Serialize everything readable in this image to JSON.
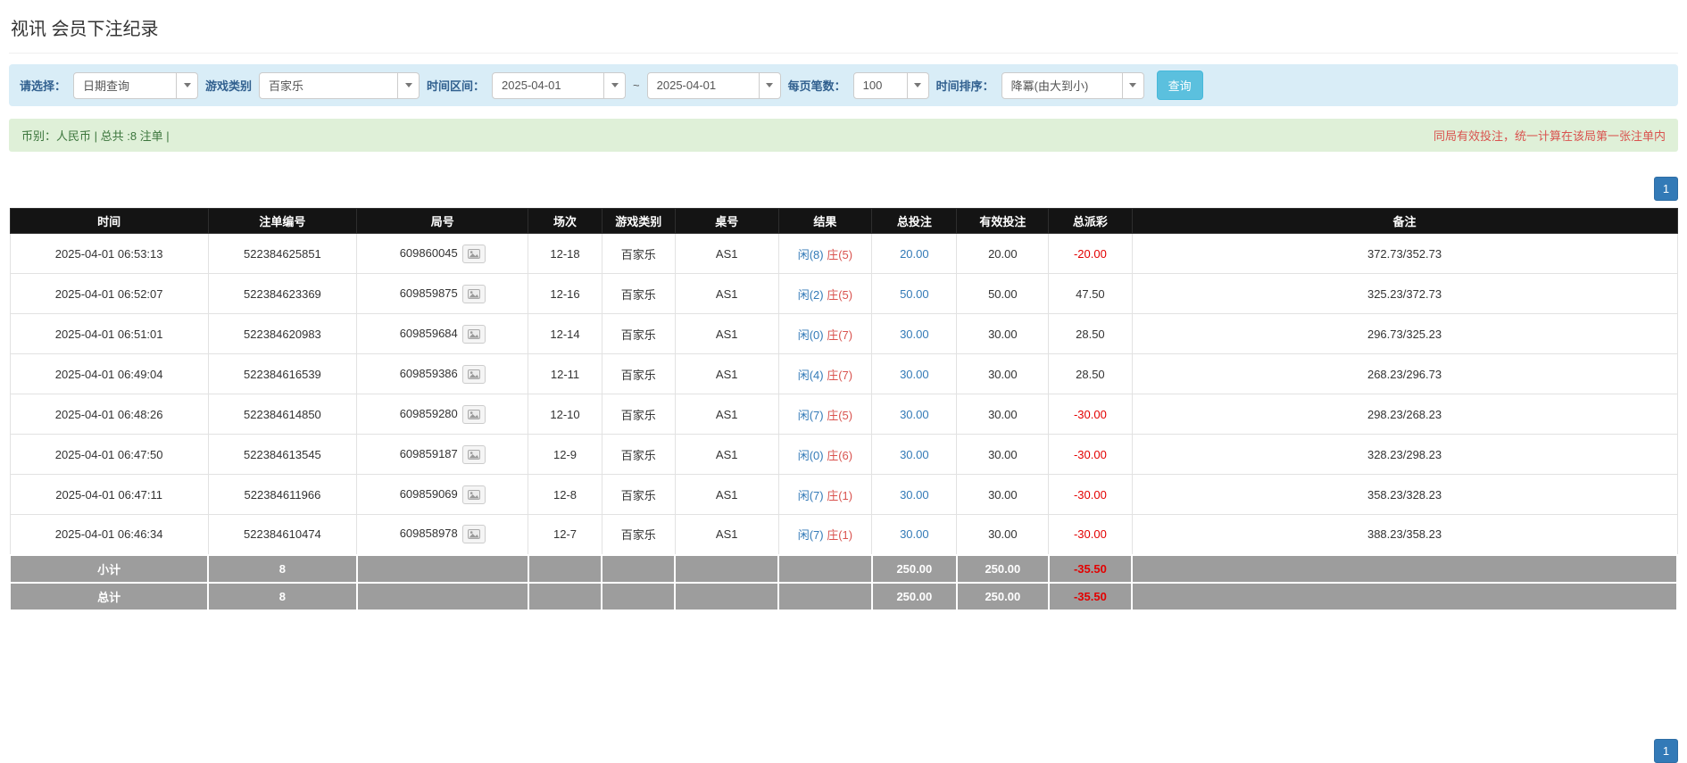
{
  "page": {
    "title": "视讯 会员下注纪录"
  },
  "filters": {
    "select_label": "请选择：",
    "select_value": "日期查询",
    "game_type_label": "游戏类别",
    "game_type_value": "百家乐",
    "date_range_label": "时间区间：",
    "date_from": "2025-04-01",
    "range_separator": "~",
    "date_to": "2025-04-01",
    "page_size_label": "每页笔数：",
    "page_size_value": "100",
    "sort_label": "时间排序：",
    "sort_value": "降冪(由大到小)",
    "search_button": "查询"
  },
  "summary": {
    "left": "币别：人民币 | 总共 :8 注单 |",
    "right": "同局有效投注，统一计算在该局第一张注单内"
  },
  "pagination": {
    "top_page": "1",
    "bottom_page": "1"
  },
  "table": {
    "headers": [
      "时间",
      "注单编号",
      "局号",
      "场次",
      "游戏类别",
      "桌号",
      "结果",
      "总投注",
      "有效投注",
      "总派彩",
      "备注"
    ],
    "rows": [
      {
        "time": "2025-04-01 06:53:13",
        "bet_id": "522384625851",
        "round_id": "609860045",
        "session": "12-18",
        "game": "百家乐",
        "table_no": "AS1",
        "result_player": "闲(8)",
        "result_banker": "庄(5)",
        "total_bet": "20.00",
        "valid_bet": "20.00",
        "payout": "-20.00",
        "note": "372.73/352.73"
      },
      {
        "time": "2025-04-01 06:52:07",
        "bet_id": "522384623369",
        "round_id": "609859875",
        "session": "12-16",
        "game": "百家乐",
        "table_no": "AS1",
        "result_player": "闲(2)",
        "result_banker": "庄(5)",
        "total_bet": "50.00",
        "valid_bet": "50.00",
        "payout": "47.50",
        "note": "325.23/372.73"
      },
      {
        "time": "2025-04-01 06:51:01",
        "bet_id": "522384620983",
        "round_id": "609859684",
        "session": "12-14",
        "game": "百家乐",
        "table_no": "AS1",
        "result_player": "闲(0)",
        "result_banker": "庄(7)",
        "total_bet": "30.00",
        "valid_bet": "30.00",
        "payout": "28.50",
        "note": "296.73/325.23"
      },
      {
        "time": "2025-04-01 06:49:04",
        "bet_id": "522384616539",
        "round_id": "609859386",
        "session": "12-11",
        "game": "百家乐",
        "table_no": "AS1",
        "result_player": "闲(4)",
        "result_banker": "庄(7)",
        "total_bet": "30.00",
        "valid_bet": "30.00",
        "payout": "28.50",
        "note": "268.23/296.73"
      },
      {
        "time": "2025-04-01 06:48:26",
        "bet_id": "522384614850",
        "round_id": "609859280",
        "session": "12-10",
        "game": "百家乐",
        "table_no": "AS1",
        "result_player": "闲(7)",
        "result_banker": "庄(5)",
        "total_bet": "30.00",
        "valid_bet": "30.00",
        "payout": "-30.00",
        "note": "298.23/268.23"
      },
      {
        "time": "2025-04-01 06:47:50",
        "bet_id": "522384613545",
        "round_id": "609859187",
        "session": "12-9",
        "game": "百家乐",
        "table_no": "AS1",
        "result_player": "闲(0)",
        "result_banker": "庄(6)",
        "total_bet": "30.00",
        "valid_bet": "30.00",
        "payout": "-30.00",
        "note": "328.23/298.23"
      },
      {
        "time": "2025-04-01 06:47:11",
        "bet_id": "522384611966",
        "round_id": "609859069",
        "session": "12-8",
        "game": "百家乐",
        "table_no": "AS1",
        "result_player": "闲(7)",
        "result_banker": "庄(1)",
        "total_bet": "30.00",
        "valid_bet": "30.00",
        "payout": "-30.00",
        "note": "358.23/328.23"
      },
      {
        "time": "2025-04-01 06:46:34",
        "bet_id": "522384610474",
        "round_id": "609858978",
        "session": "12-7",
        "game": "百家乐",
        "table_no": "AS1",
        "result_player": "闲(7)",
        "result_banker": "庄(1)",
        "total_bet": "30.00",
        "valid_bet": "30.00",
        "payout": "-30.00",
        "note": "388.23/358.23"
      }
    ],
    "subtotal": {
      "label": "小计",
      "count": "8",
      "total_bet": "250.00",
      "valid_bet": "250.00",
      "payout": "-35.50"
    },
    "total": {
      "label": "总计",
      "count": "8",
      "total_bet": "250.00",
      "valid_bet": "250.00",
      "payout": "-35.50"
    }
  }
}
